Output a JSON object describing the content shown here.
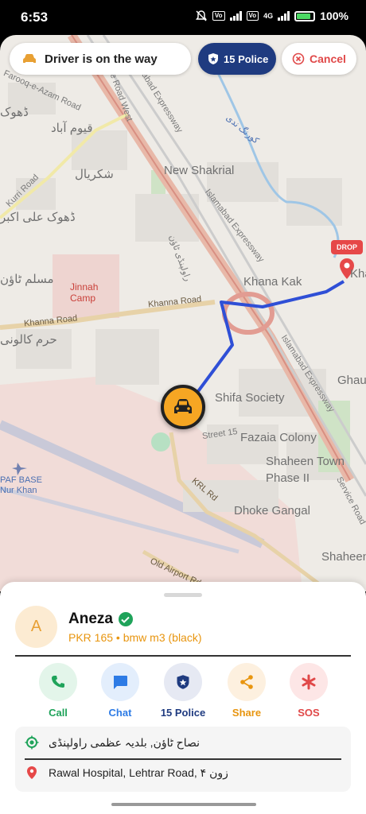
{
  "status_bar": {
    "time": "6:53",
    "battery": "100%",
    "net1": "Vo\nLTE",
    "net2": "4G"
  },
  "top": {
    "status_text": "Driver is on the way",
    "police_label": "15 Police",
    "cancel_label": "Cancel"
  },
  "map": {
    "drop_tag": "DROP",
    "labels": {
      "service_road_west": "Service Road West",
      "islamabad_expressway_1": "Islamabad Expressway",
      "islamabad_expressway_2": "Islamabad Expressway",
      "islamabad_expressway_3": "Islamabad Expressway",
      "new_shakrial": "New Shakrial",
      "shakrial_ur": "شکریال",
      "qayyum_abad_ur": "قیوم آباد",
      "kurri_road": "Kurri Road",
      "dhoke_ali_ur": "ڈھوک علی اکبر",
      "muslim_town_ur": "مسلم ٹاؤن",
      "jinnah_camp": "Jinnah\nCamp",
      "khanna_road_1": "Khanna Road",
      "khanna_road_2": "Khanna Road",
      "khana_kak": "Khana Kak",
      "shifa_society": "Shifa Society",
      "street_15": "Street 15",
      "fazaia_colony": "Fazaia Colony",
      "shaheen_town": "Shaheen Town\nPhase II",
      "dhoke_gangal": "Dhoke Gangal",
      "krl_rd": "KRL Rd",
      "paf_base": "PAF BASE\nNur Khan",
      "old_airport_rd": "Old Airport Rd",
      "shaheen_right": "Shaheen Te",
      "ghau": "Ghau",
      "kha_right": "Kha",
      "service_road_right": "Service Road",
      "korang_ur": "کورنگ ندی",
      "rawalpindi_ur": "راولپنڈی ٹاؤن",
      "hiram_ur": "حرم کالونی",
      "farooq_azam": "Farooq-e-Azam Road",
      "dhoke_ur_top": "ڈھوک"
    }
  },
  "driver": {
    "avatar_letter": "A",
    "name": "Aneza",
    "ride_info": "PKR 165 • bmw m3 (black)"
  },
  "actions": [
    {
      "label": "Call",
      "color": "#1fa35a",
      "bg": "#e3f5ea",
      "icon": "phone-icon"
    },
    {
      "label": "Chat",
      "color": "#2d7be5",
      "bg": "#e3eefc",
      "icon": "chat-icon"
    },
    {
      "label": "15 Police",
      "color": "#1f3b80",
      "bg": "#e6e9f3",
      "icon": "police-shield-icon"
    },
    {
      "label": "Share",
      "color": "#e8950f",
      "bg": "#fdf0df",
      "icon": "share-icon"
    },
    {
      "label": "SOS",
      "color": "#e04848",
      "bg": "#fde6e6",
      "icon": "sos-asterisk-icon"
    }
  ],
  "addresses": {
    "pickup": "نصاح ٹاؤن, بلدیہ عظمی راولپنڈی",
    "drop": "Rawal Hospital, Lehtrar Road, زون ۴"
  },
  "colors": {
    "route": "#2f4fd6",
    "accent": "#f6a623",
    "police": "#1f3b80",
    "danger": "#e04848"
  }
}
